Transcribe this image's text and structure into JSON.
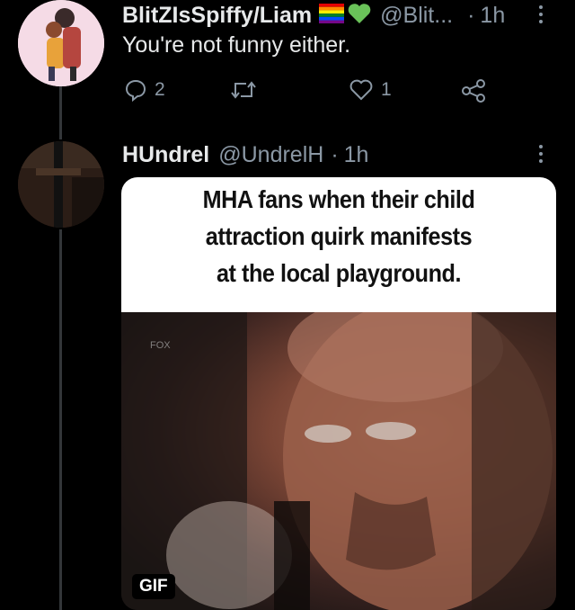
{
  "tweet1": {
    "display_name": "BlitZIsSpiffy/Liam",
    "handle": "@Blit...",
    "separator": "·",
    "time": "1h",
    "text": "You're not funny either.",
    "reply_count": "2",
    "retweet_count": "",
    "like_count": "1",
    "flags": [
      "rainbow-flag-emoji",
      "green-heart-emoji"
    ]
  },
  "tweet2": {
    "display_name": "HUndrel",
    "handle": "@UndrelH",
    "separator": "·",
    "time": "1h",
    "media": {
      "caption_lines": [
        "MHA fans when their child",
        "attraction quirk manifests",
        "at the local playground."
      ],
      "badge": "GIF"
    }
  },
  "colors": {
    "background": "#000000",
    "text": "#e7e9ea",
    "muted": "#8b98a5"
  }
}
